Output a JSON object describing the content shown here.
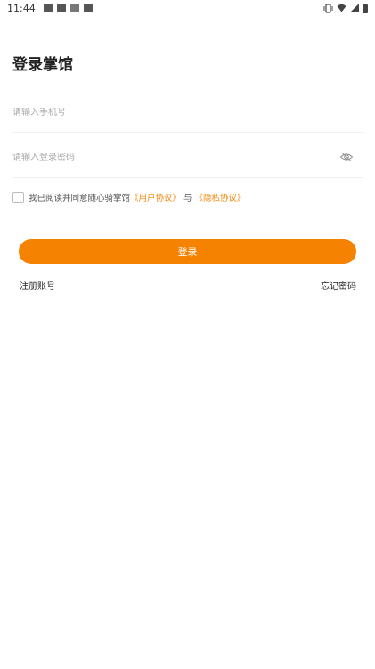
{
  "status_bar": {
    "time": "11:44",
    "notification_icons": [
      "app-notification-icon",
      "app-notification-icon",
      "a-notification-icon",
      "app-notification-icon"
    ],
    "right_icons": [
      "vibrate-icon",
      "wifi-icon",
      "signal-icon",
      "battery-icon"
    ]
  },
  "page": {
    "title": "登录掌馆"
  },
  "form": {
    "phone_placeholder": "请输入手机号",
    "phone_value": "",
    "password_placeholder": "请输入登录密码",
    "password_value": "",
    "password_toggle_icon": "eye-off-icon"
  },
  "agreement": {
    "checked": false,
    "prefix": "我已阅读并同意随心骑掌馆",
    "user_agreement": "《用户协议》",
    "conjunction": "与",
    "privacy_policy": "《隐私协议》"
  },
  "actions": {
    "login_label": "登录",
    "register_label": "注册账号",
    "forgot_label": "忘记密码"
  },
  "colors": {
    "accent": "#f58200",
    "link": "#f5860b"
  }
}
